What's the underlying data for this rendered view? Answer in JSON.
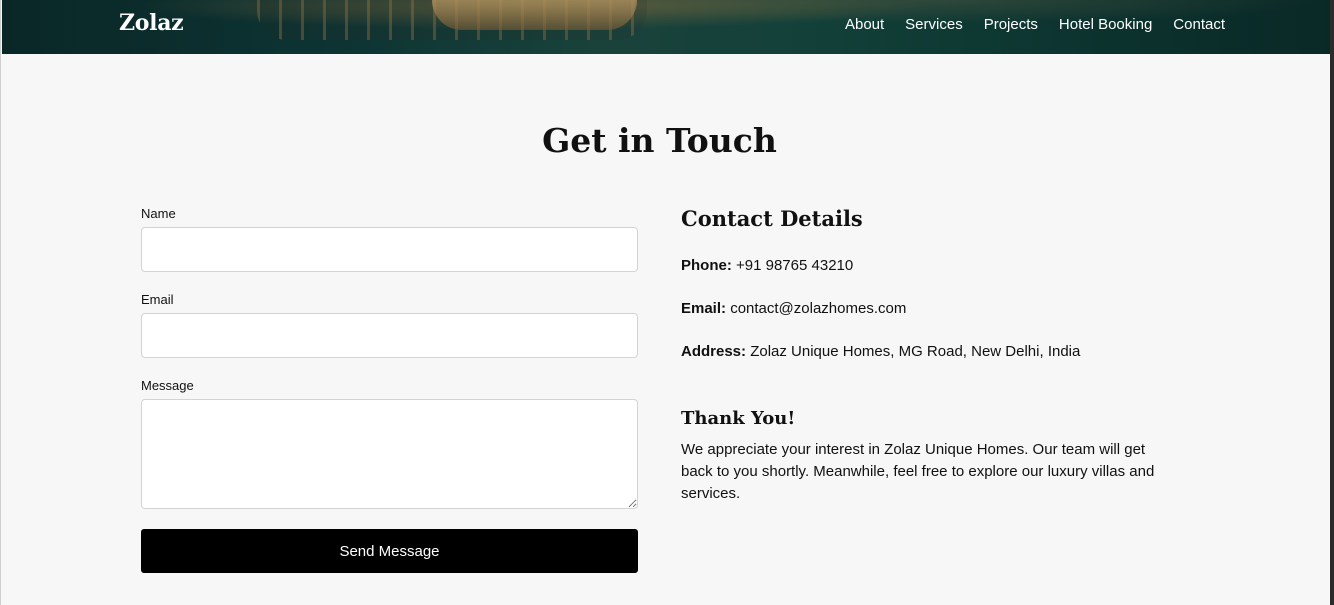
{
  "brand": "Zolaz",
  "nav": {
    "items": [
      "About",
      "Services",
      "Projects",
      "Hotel Booking",
      "Contact"
    ]
  },
  "contact": {
    "title": "Get in Touch",
    "form": {
      "name_label": "Name",
      "name_value": "",
      "email_label": "Email",
      "email_value": "",
      "message_label": "Message",
      "message_value": "",
      "submit_label": "Send Message"
    },
    "details": {
      "heading": "Contact Details",
      "phone_label": "Phone:",
      "phone_value": "+91 98765 43210",
      "email_label": "Email:",
      "email_value": "contact@zolazhomes.com",
      "address_label": "Address:",
      "address_value": "Zolaz Unique Homes, MG Road, New Delhi, India"
    },
    "thanks": {
      "heading": "Thank You!",
      "text": "We appreciate your interest in Zolaz Unique Homes. Our team will get back to you shortly. Meanwhile, feel free to explore our luxury villas and services."
    }
  },
  "colors": {
    "page_background": "#f7f7f7",
    "button_background": "#000000",
    "nav_text": "#ffffff"
  }
}
